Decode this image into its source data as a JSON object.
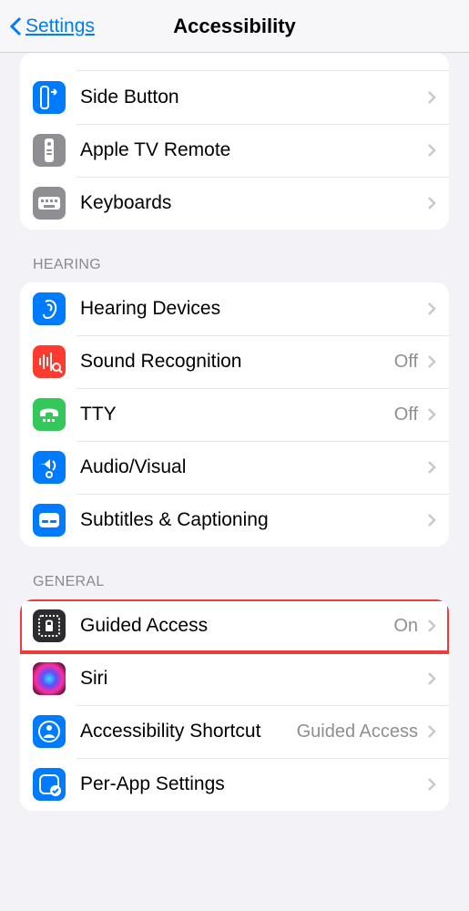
{
  "nav": {
    "back_label": "Settings",
    "title": "Accessibility"
  },
  "groups": [
    {
      "header": null,
      "partial_top": true,
      "items": [
        {
          "id": "side-button",
          "icon": "side-button-icon",
          "bg": "bg-blue",
          "label": "Side Button",
          "value": ""
        },
        {
          "id": "apple-tv-remote",
          "icon": "remote-icon",
          "bg": "bg-gray",
          "label": "Apple TV Remote",
          "value": ""
        },
        {
          "id": "keyboards",
          "icon": "keyboard-icon",
          "bg": "bg-gray",
          "label": "Keyboards",
          "value": ""
        }
      ]
    },
    {
      "header": "HEARING",
      "items": [
        {
          "id": "hearing-devices",
          "icon": "ear-icon",
          "bg": "bg-blue",
          "label": "Hearing Devices",
          "value": ""
        },
        {
          "id": "sound-recognition",
          "icon": "waveform-icon",
          "bg": "bg-red",
          "label": "Sound Recognition",
          "value": "Off"
        },
        {
          "id": "tty",
          "icon": "tty-icon",
          "bg": "bg-green",
          "label": "TTY",
          "value": "Off"
        },
        {
          "id": "audio-visual",
          "icon": "speaker-eye-icon",
          "bg": "bg-blue",
          "label": "Audio/Visual",
          "value": ""
        },
        {
          "id": "subtitles",
          "icon": "caption-icon",
          "bg": "bg-blue",
          "label": "Subtitles & Captioning",
          "value": ""
        }
      ]
    },
    {
      "header": "GENERAL",
      "items": [
        {
          "id": "guided-access",
          "icon": "lock-frame-icon",
          "bg": "bg-dark",
          "label": "Guided Access",
          "value": "On",
          "highlight": true
        },
        {
          "id": "siri",
          "icon": "siri-icon",
          "bg": "bg-siri",
          "label": "Siri",
          "value": ""
        },
        {
          "id": "accessibility-shortcut",
          "icon": "person-circle-icon",
          "bg": "bg-blue",
          "label": "Accessibility Shortcut",
          "value": "Guided Access"
        },
        {
          "id": "per-app-settings",
          "icon": "app-check-icon",
          "bg": "bg-blue",
          "label": "Per-App Settings",
          "value": ""
        }
      ]
    }
  ]
}
